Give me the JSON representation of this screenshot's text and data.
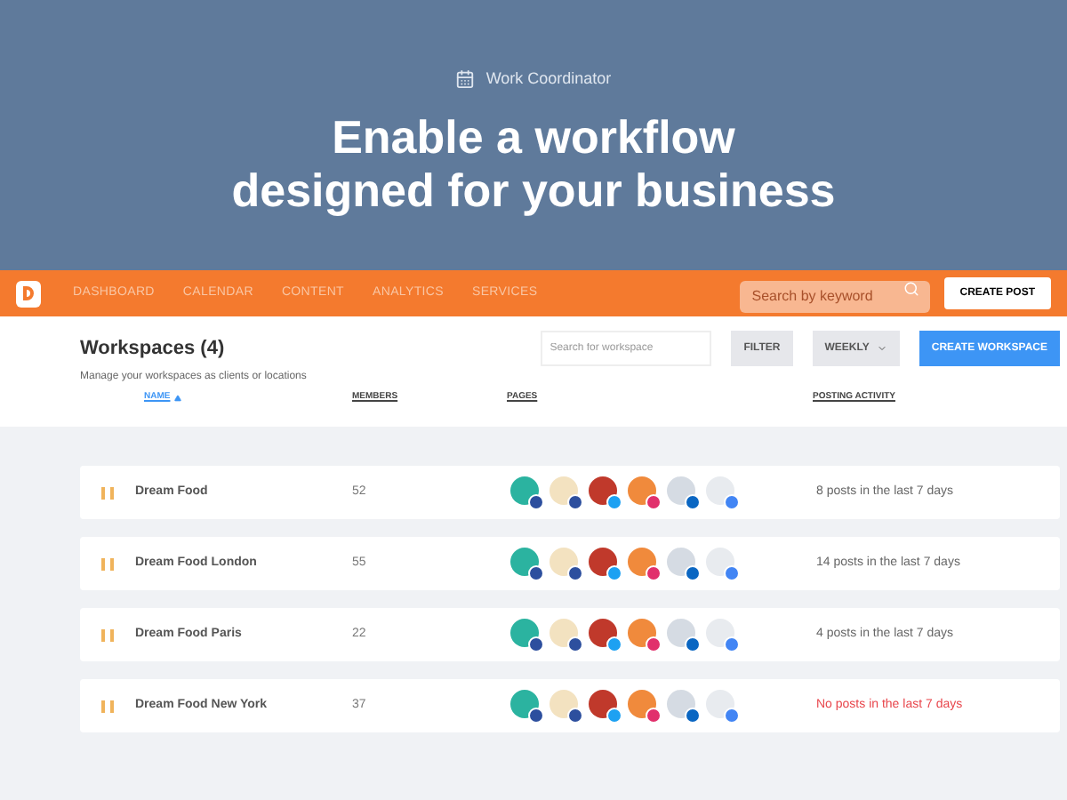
{
  "banner": {
    "label": "Work Coordinator",
    "headline": [
      "Enable a workflow",
      "designed for your business"
    ]
  },
  "nav": {
    "items": [
      "DASHBOARD",
      "CALENDAR",
      "CONTENT",
      "ANALYTICS",
      "SERVICES"
    ],
    "search": {
      "placeholder": "Search by keyword"
    },
    "button": "CREATE POST"
  },
  "header": {
    "title": "Workspaces (4)",
    "subtitle": "Manage your workspaces as clients or locations",
    "search": {
      "placeholder": "Search for workspace"
    },
    "filter": "FILTER",
    "period": "WEEKLY",
    "create": "CREATE WORKSPACE"
  },
  "columns": [
    {
      "label": "NAME",
      "sorted": true
    },
    {
      "label": "MEMBERS",
      "sorted": false
    },
    {
      "label": "PAGES",
      "sorted": false
    },
    {
      "label": "POSTING ACTIVITY",
      "sorted": false
    }
  ],
  "rows": [
    {
      "name": "Dream Food",
      "members": "52",
      "pages": [
        {
          "kind": "facebook"
        },
        {
          "kind": "facebook"
        },
        {
          "kind": "twitter"
        },
        {
          "kind": "instagram"
        },
        {
          "kind": "linkedin"
        },
        {
          "kind": "google"
        }
      ],
      "activity": "8 posts in the last 7 days",
      "warning": false
    },
    {
      "name": "Dream Food London",
      "members": "55",
      "pages": [
        {
          "kind": "facebook"
        },
        {
          "kind": "facebook"
        },
        {
          "kind": "twitter"
        },
        {
          "kind": "instagram"
        },
        {
          "kind": "linkedin"
        },
        {
          "kind": "google"
        }
      ],
      "activity": "14 posts in the last 7 days",
      "warning": false
    },
    {
      "name": "Dream Food Paris",
      "members": "22",
      "pages": [
        {
          "kind": "facebook"
        },
        {
          "kind": "facebook"
        },
        {
          "kind": "twitter"
        },
        {
          "kind": "instagram"
        },
        {
          "kind": "linkedin"
        },
        {
          "kind": "google"
        }
      ],
      "activity": "4 posts in the last 7 days",
      "warning": false
    },
    {
      "name": "Dream Food New York",
      "members": "37",
      "pages": [
        {
          "kind": "facebook"
        },
        {
          "kind": "facebook"
        },
        {
          "kind": "twitter"
        },
        {
          "kind": "instagram"
        },
        {
          "kind": "linkedin"
        },
        {
          "kind": "google"
        }
      ],
      "activity": "No posts in the last 7 days",
      "warning": true
    }
  ]
}
